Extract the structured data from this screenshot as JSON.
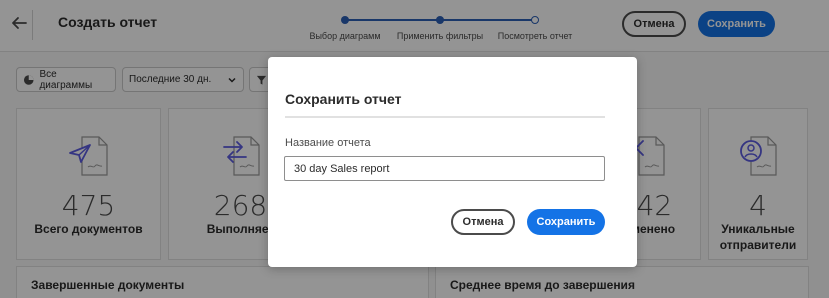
{
  "header": {
    "title": "Создать отчет",
    "steps": [
      "Выбор диаграмм",
      "Применить фильтры",
      "Посмотреть отчет"
    ],
    "cancel_label": "Отмена",
    "save_label": "Сохранить"
  },
  "toolbar": {
    "all_charts_label": "Все диаграммы",
    "period_label": "Последние 30 дн.",
    "filter_label": "",
    "accent_color": "#1473e6"
  },
  "cards": [
    {
      "icon": "send-document-icon",
      "value": "475",
      "label": "Всего документов"
    },
    {
      "icon": "in-progress-document-icon",
      "value": "268",
      "label": "Выполняет"
    },
    {
      "icon": "cancelled-document-icon",
      "value": "142",
      "label": "Отменено"
    },
    {
      "icon": "sender-document-icon",
      "value": "4",
      "label": "Уникальные отправители"
    }
  ],
  "panels": [
    "Завершенные документы",
    "Среднее время до завершения"
  ],
  "modal": {
    "title": "Сохранить отчет",
    "field_label": "Название отчета",
    "field_value": "30 day Sales report",
    "cancel_label": "Отмена",
    "save_label": "Сохранить"
  }
}
